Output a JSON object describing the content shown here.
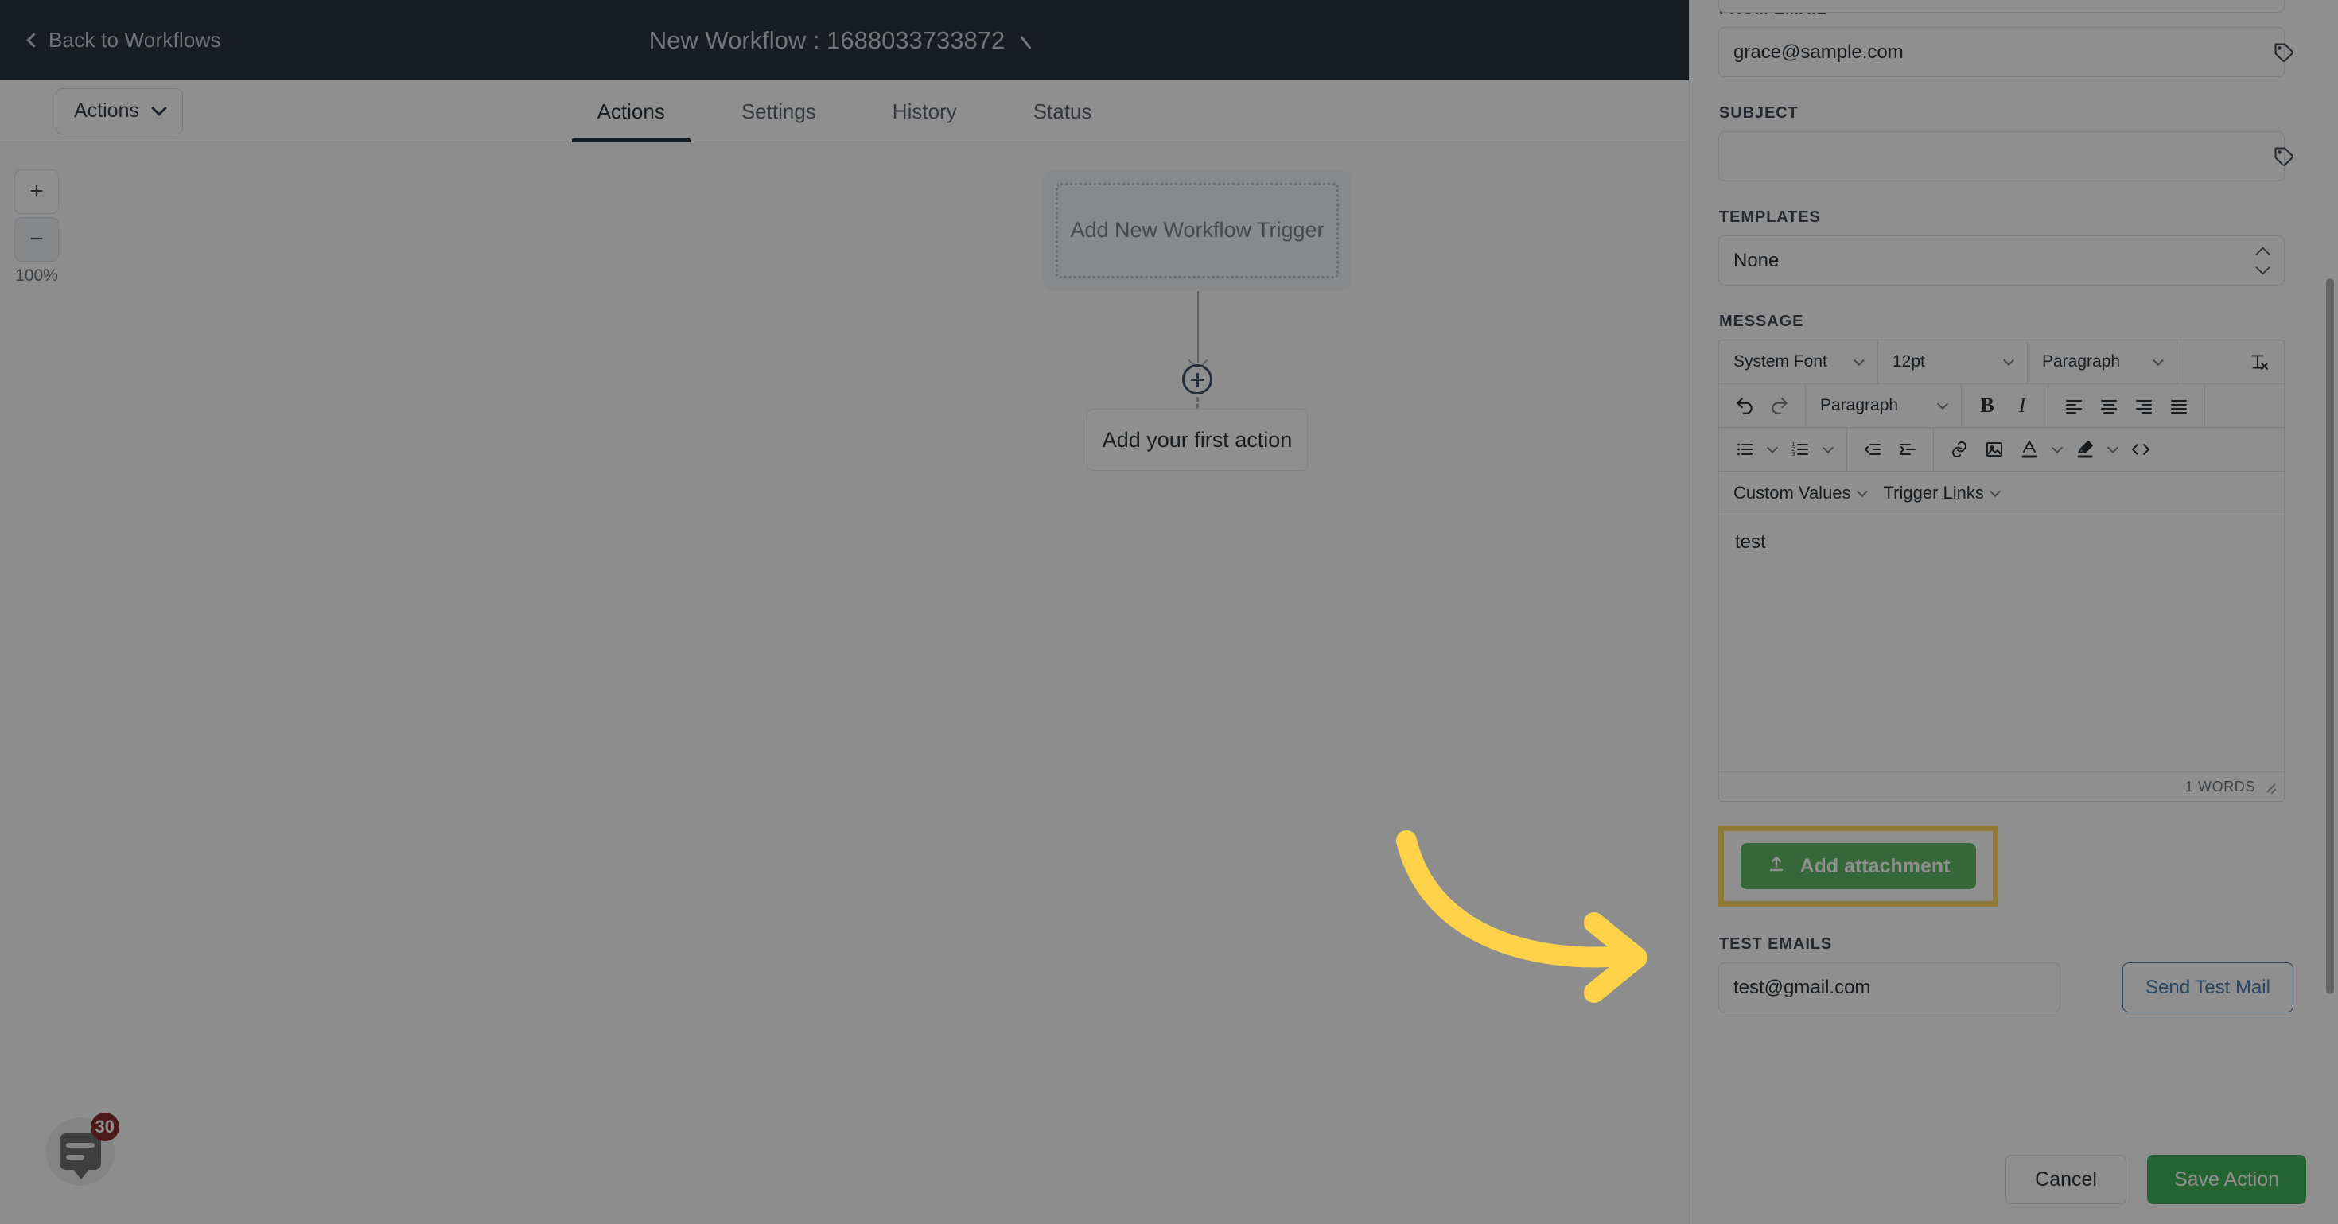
{
  "topbar": {
    "back_label": "Back to Workflows",
    "back_icon": "chevron-left-icon",
    "title": "New Workflow : 1688033733872",
    "edit_icon": "pencil-icon"
  },
  "tabs": {
    "actions_dropdown_label": "Actions",
    "items": [
      {
        "label": "Actions",
        "active": true
      },
      {
        "label": "Settings",
        "active": false
      },
      {
        "label": "History",
        "active": false
      },
      {
        "label": "Status",
        "active": false
      }
    ]
  },
  "canvas": {
    "zoom_in_label": "+",
    "zoom_out_label": "−",
    "zoom_level": "100%",
    "trigger_placeholder": "Add New Workflow Trigger",
    "add_action_label": "Add your first action",
    "plus_node_icon": "plus-circle-icon"
  },
  "chat_widget": {
    "icon": "chat-bubble-icon",
    "badge_count": "30"
  },
  "panel": {
    "from_email": {
      "label": "FROM EMAIL",
      "value": "grace@sample.com",
      "tag_icon": "tag-icon"
    },
    "subject": {
      "label": "SUBJECT",
      "value": "",
      "placeholder": "",
      "tag_icon": "tag-icon"
    },
    "templates": {
      "label": "TEMPLATES",
      "value": "None",
      "stepper_icon": "chevron-updown-icon"
    },
    "message": {
      "label": "MESSAGE",
      "toolbar_row1": {
        "font_family": "System Font",
        "font_size": "12pt",
        "block_format": "Paragraph",
        "clear_format_icon": "clear-formatting-icon"
      },
      "toolbar_row2": {
        "undo_icon": "undo-icon",
        "redo_icon": "redo-icon",
        "block_format": "Paragraph",
        "bold_label": "B",
        "italic_label": "I",
        "align_left_icon": "align-left-icon",
        "align_center_icon": "align-center-icon",
        "align_right_icon": "align-right-icon",
        "align_justify_icon": "align-justify-icon"
      },
      "toolbar_row3": {
        "bullet_list_icon": "bullet-list-icon",
        "numbered_list_icon": "numbered-list-icon",
        "outdent_icon": "outdent-icon",
        "indent_icon": "indent-icon",
        "link_icon": "link-icon",
        "image_icon": "image-icon",
        "text_color_icon": "text-color-icon",
        "highlight_icon": "highlight-icon",
        "source_code_icon": "source-code-icon"
      },
      "merge_row": {
        "custom_values": "Custom Values",
        "trigger_links": "Trigger Links"
      },
      "body_text": "test",
      "word_count": "1 WORDS",
      "resize_icon": "resize-grip-icon"
    },
    "add_attachment": {
      "label": "Add attachment",
      "icon": "upload-icon",
      "highlighted": true
    },
    "test_emails": {
      "label": "TEST EMAILS",
      "value": "test@gmail.com",
      "send_label": "Send Test Mail"
    },
    "footer": {
      "cancel_label": "Cancel",
      "save_label": "Save Action"
    }
  },
  "annotation": {
    "arrow_icon": "curved-arrow-right-icon",
    "arrow_color": "#FFD24A",
    "highlight_color": "#FFD24A"
  },
  "colors": {
    "topbar_bg": "#101A22",
    "accent_green": "#4CAF50",
    "save_green": "#28A745",
    "link_blue": "#2F6CA3",
    "badge_red": "#7A1414"
  }
}
